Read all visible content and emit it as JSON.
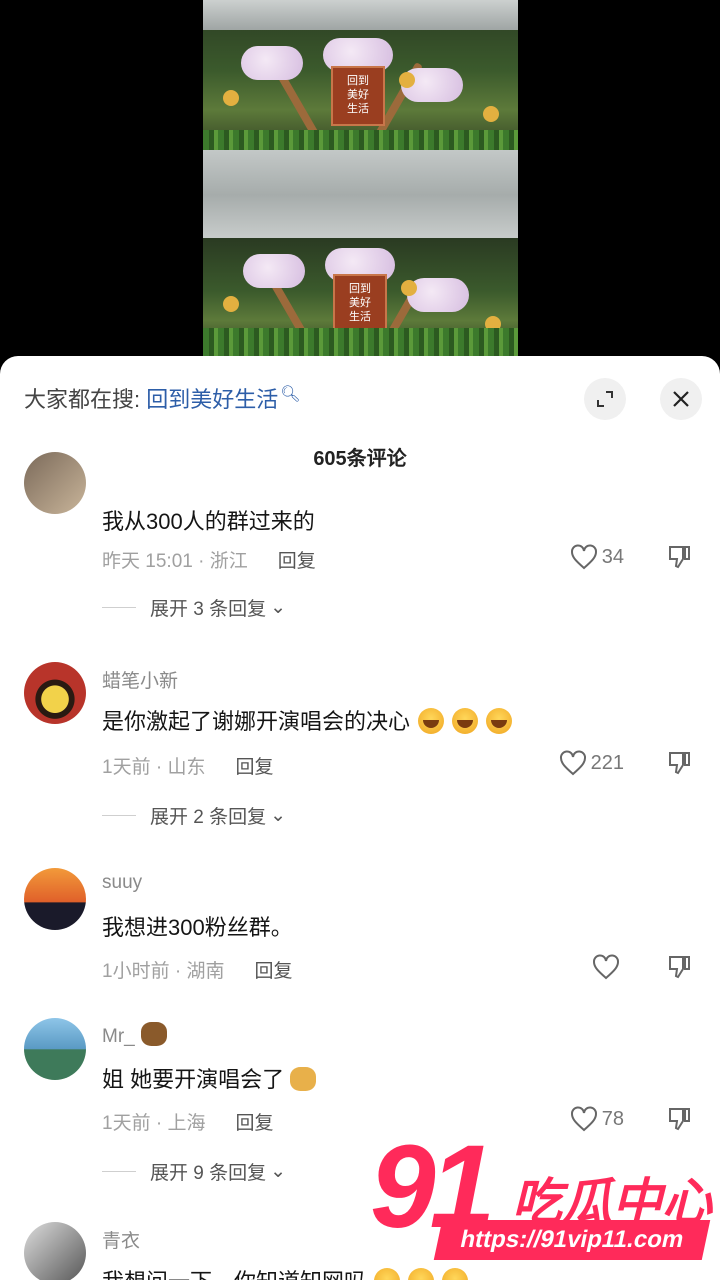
{
  "sheet": {
    "search_prefix": "大家都在搜:",
    "search_keyword": "回到美好生活",
    "comment_count": "605条评论"
  },
  "comments": [
    {
      "username": "",
      "text": "我从300人的群过来的",
      "time_location": "昨天 15:01 · 浙江",
      "reply_label": "回复",
      "likes": "34",
      "expand": "展开 3 条回复"
    },
    {
      "username": "蜡笔小新",
      "text": "是你激起了谢娜开演唱会的决心",
      "time_location": "1天前 · 山东",
      "reply_label": "回复",
      "likes": "221",
      "expand": "展开 2 条回复"
    },
    {
      "username": "suuy",
      "text": "我想进300粉丝群。",
      "time_location": "1小时前 · 湖南",
      "reply_label": "回复",
      "likes": ""
    },
    {
      "username": "Mr_",
      "text": "姐 她要开演唱会了",
      "time_location": "1天前 · 上海",
      "reply_label": "回复",
      "likes": "78",
      "expand": "展开 9 条回复"
    },
    {
      "username": "青衣",
      "text": "我想问一下，你知道知网吗"
    }
  ],
  "watermark": {
    "number": "91",
    "name": "吃瓜中心",
    "url": "https://91vip11.com"
  },
  "icons": {
    "expand": "expand-icon",
    "close": "close-icon",
    "heart": "heart-icon",
    "dislike": "dislike-icon",
    "search": "search-icon"
  }
}
